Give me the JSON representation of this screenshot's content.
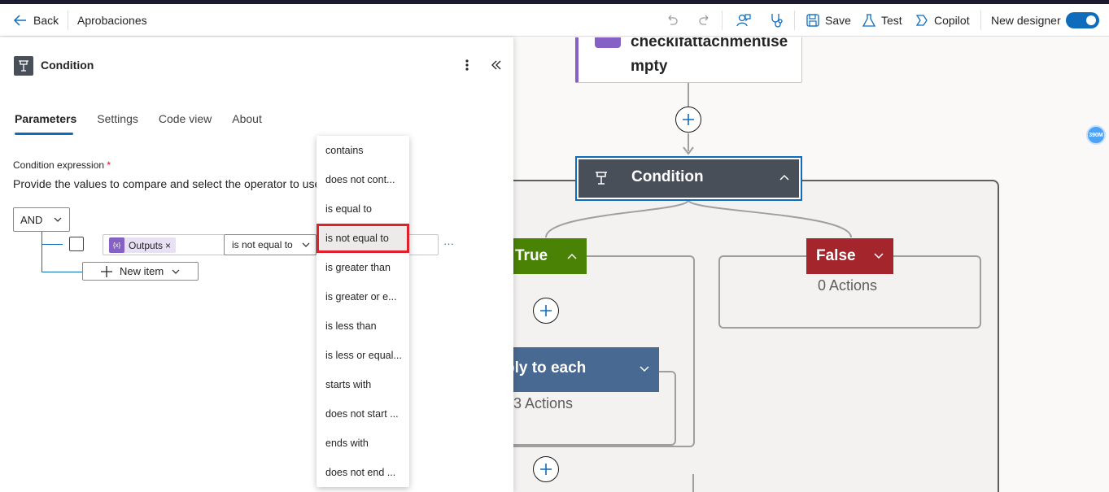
{
  "topbar": {
    "back_label": "Back",
    "flow_name": "Aprobaciones",
    "save_label": "Save",
    "test_label": "Test",
    "copilot_label": "Copilot",
    "new_designer_label": "New designer"
  },
  "panel": {
    "title": "Condition",
    "tabs": [
      "Parameters",
      "Settings",
      "Code view",
      "About"
    ],
    "condition_label": "Condition expression",
    "required_mark": "*",
    "description": "Provide the values to compare and select the operator to use.",
    "group_operator": "AND",
    "token_label": "Outputs",
    "token_remove": "×",
    "operator_value": "is not equal to",
    "more_label": "···",
    "new_item_label": "New item"
  },
  "dropdown": {
    "options": [
      "contains",
      "does not cont...",
      "is equal to",
      "is not equal to",
      "is greater than",
      "is greater or e...",
      "is less than",
      "is less or equal...",
      "starts with",
      "does not start ...",
      "ends with",
      "does not end ..."
    ],
    "selected": "is not equal to"
  },
  "canvas": {
    "prev_action_title": "checkifattachmentise mpty",
    "prev_action_line1": "checkifattachmentise",
    "prev_action_line2": "mpty",
    "condition_title": "Condition",
    "true_label": "True",
    "false_label": "False",
    "false_actions": "0 Actions",
    "apply_each_title": "ply to each",
    "apply_each_actions": "3 Actions",
    "badge": "390M"
  },
  "colors": {
    "accent": "#0f6cbd",
    "condition_header": "#484f58",
    "true_green": "#498205",
    "false_red": "#a4262c",
    "apply_blue": "#486991",
    "highlight_red": "#e0202a"
  }
}
